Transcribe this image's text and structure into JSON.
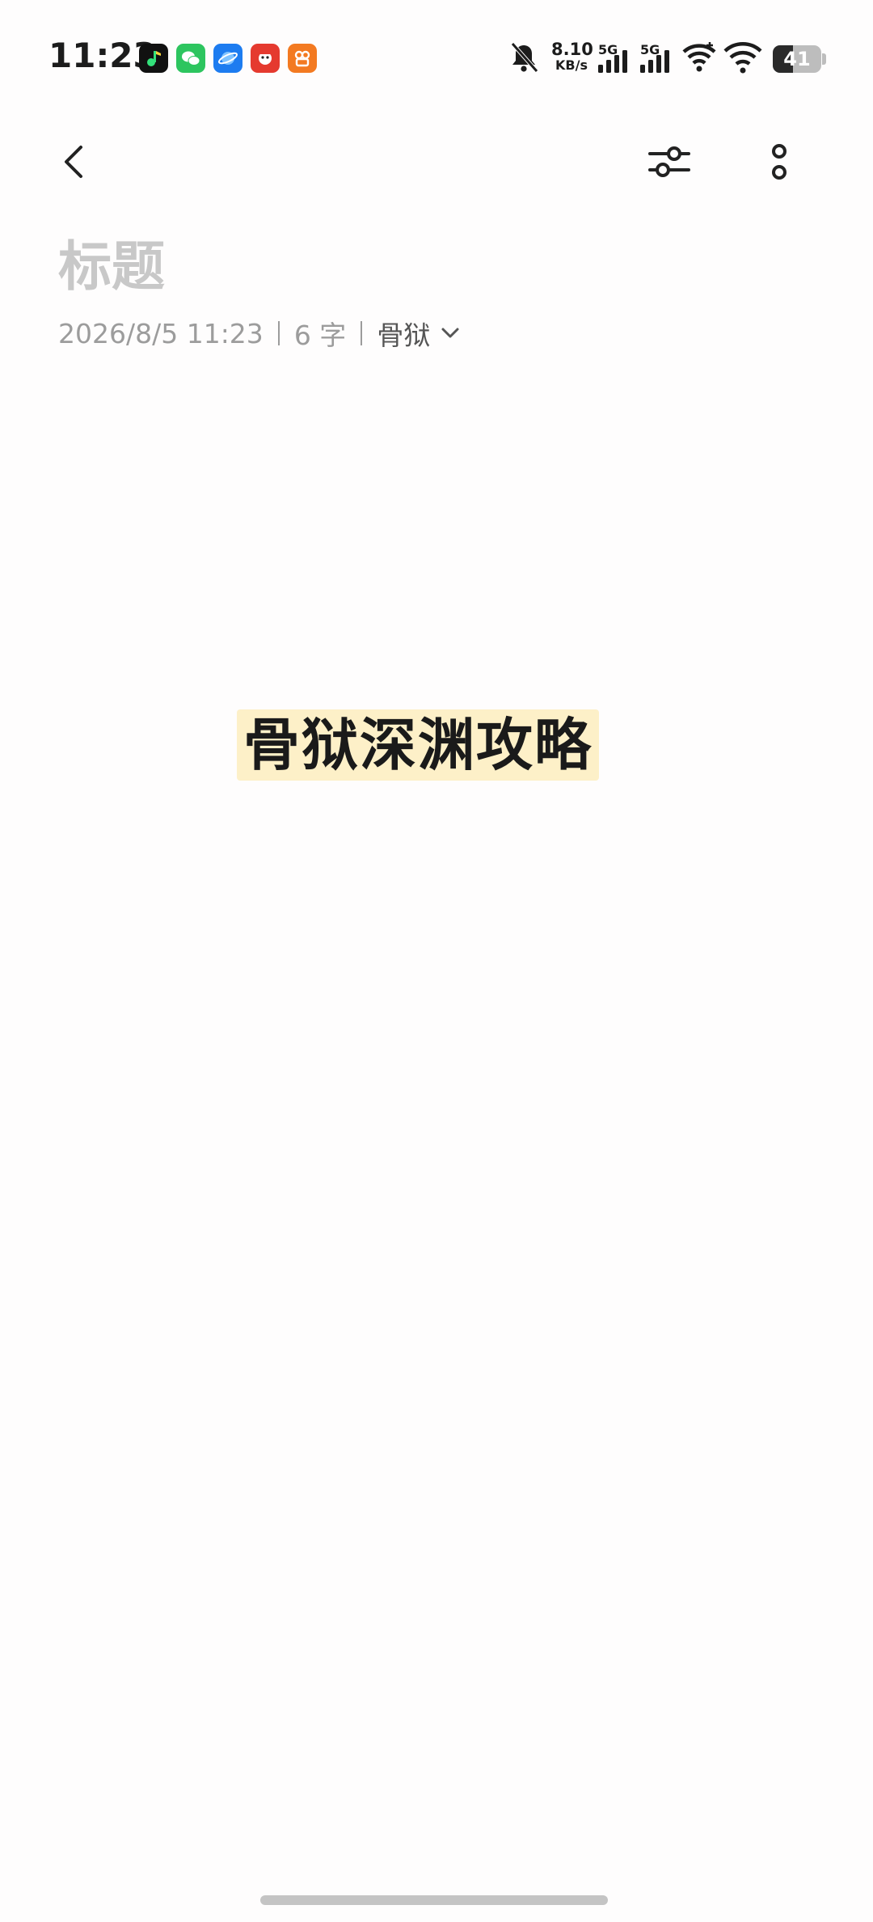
{
  "status_bar": {
    "time": "11:23",
    "net_speed_value": "8.10",
    "net_speed_unit": "KB/s",
    "sim1_label": "5G",
    "sim2_label": "5G",
    "battery_level": "41",
    "battery_fraction": 0.41,
    "app_icons": [
      "music-app-icon",
      "wechat-app-icon",
      "browser-app-icon",
      "xiaohongshu-mascot-app-icon",
      "kuaishou-app-icon"
    ]
  },
  "toolbar": {
    "back_icon": "chevron-left-icon",
    "settings_icon": "sliders-icon",
    "more_icon": "more-vertical-icon"
  },
  "note": {
    "title_placeholder": "标题",
    "date": "2026/8/5 11:23",
    "word_count": "6 字",
    "folder": "骨狱",
    "body_text": "骨狱深渊攻略",
    "highlight_color": "#fdf0c8"
  }
}
